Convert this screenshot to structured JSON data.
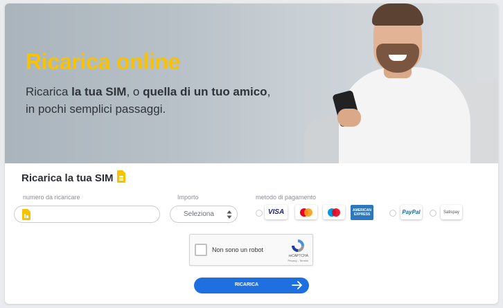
{
  "hero": {
    "title": "Ricarica online",
    "subtitle_pre": "Ricarica ",
    "subtitle_bold1": "la tua SIM",
    "subtitle_mid": ", o ",
    "subtitle_bold2": "quella di un tuo amico",
    "subtitle_post": ",",
    "subtitle_line2": "in pochi semplici passaggi."
  },
  "form": {
    "section_title": "Ricarica la tua SIM",
    "number_label": "numero da ricaricare",
    "number_value": "",
    "amount_label": "Importo",
    "amount_value": "Seleziona",
    "payment_label": "metodo di pagamento",
    "payment_methods": [
      "VISA",
      "mastercard",
      "maestro",
      "AMERICAN EXPRESS",
      "PayPal",
      "Satispay"
    ],
    "captcha_text": "Non sono un robot",
    "captcha_brand": "reCAPTCHA",
    "captcha_terms": "Privacy - Termini",
    "submit_label": "RICARICA"
  },
  "colors": {
    "accent_yellow": "#f7c200",
    "primary_blue": "#1e6fe0"
  }
}
